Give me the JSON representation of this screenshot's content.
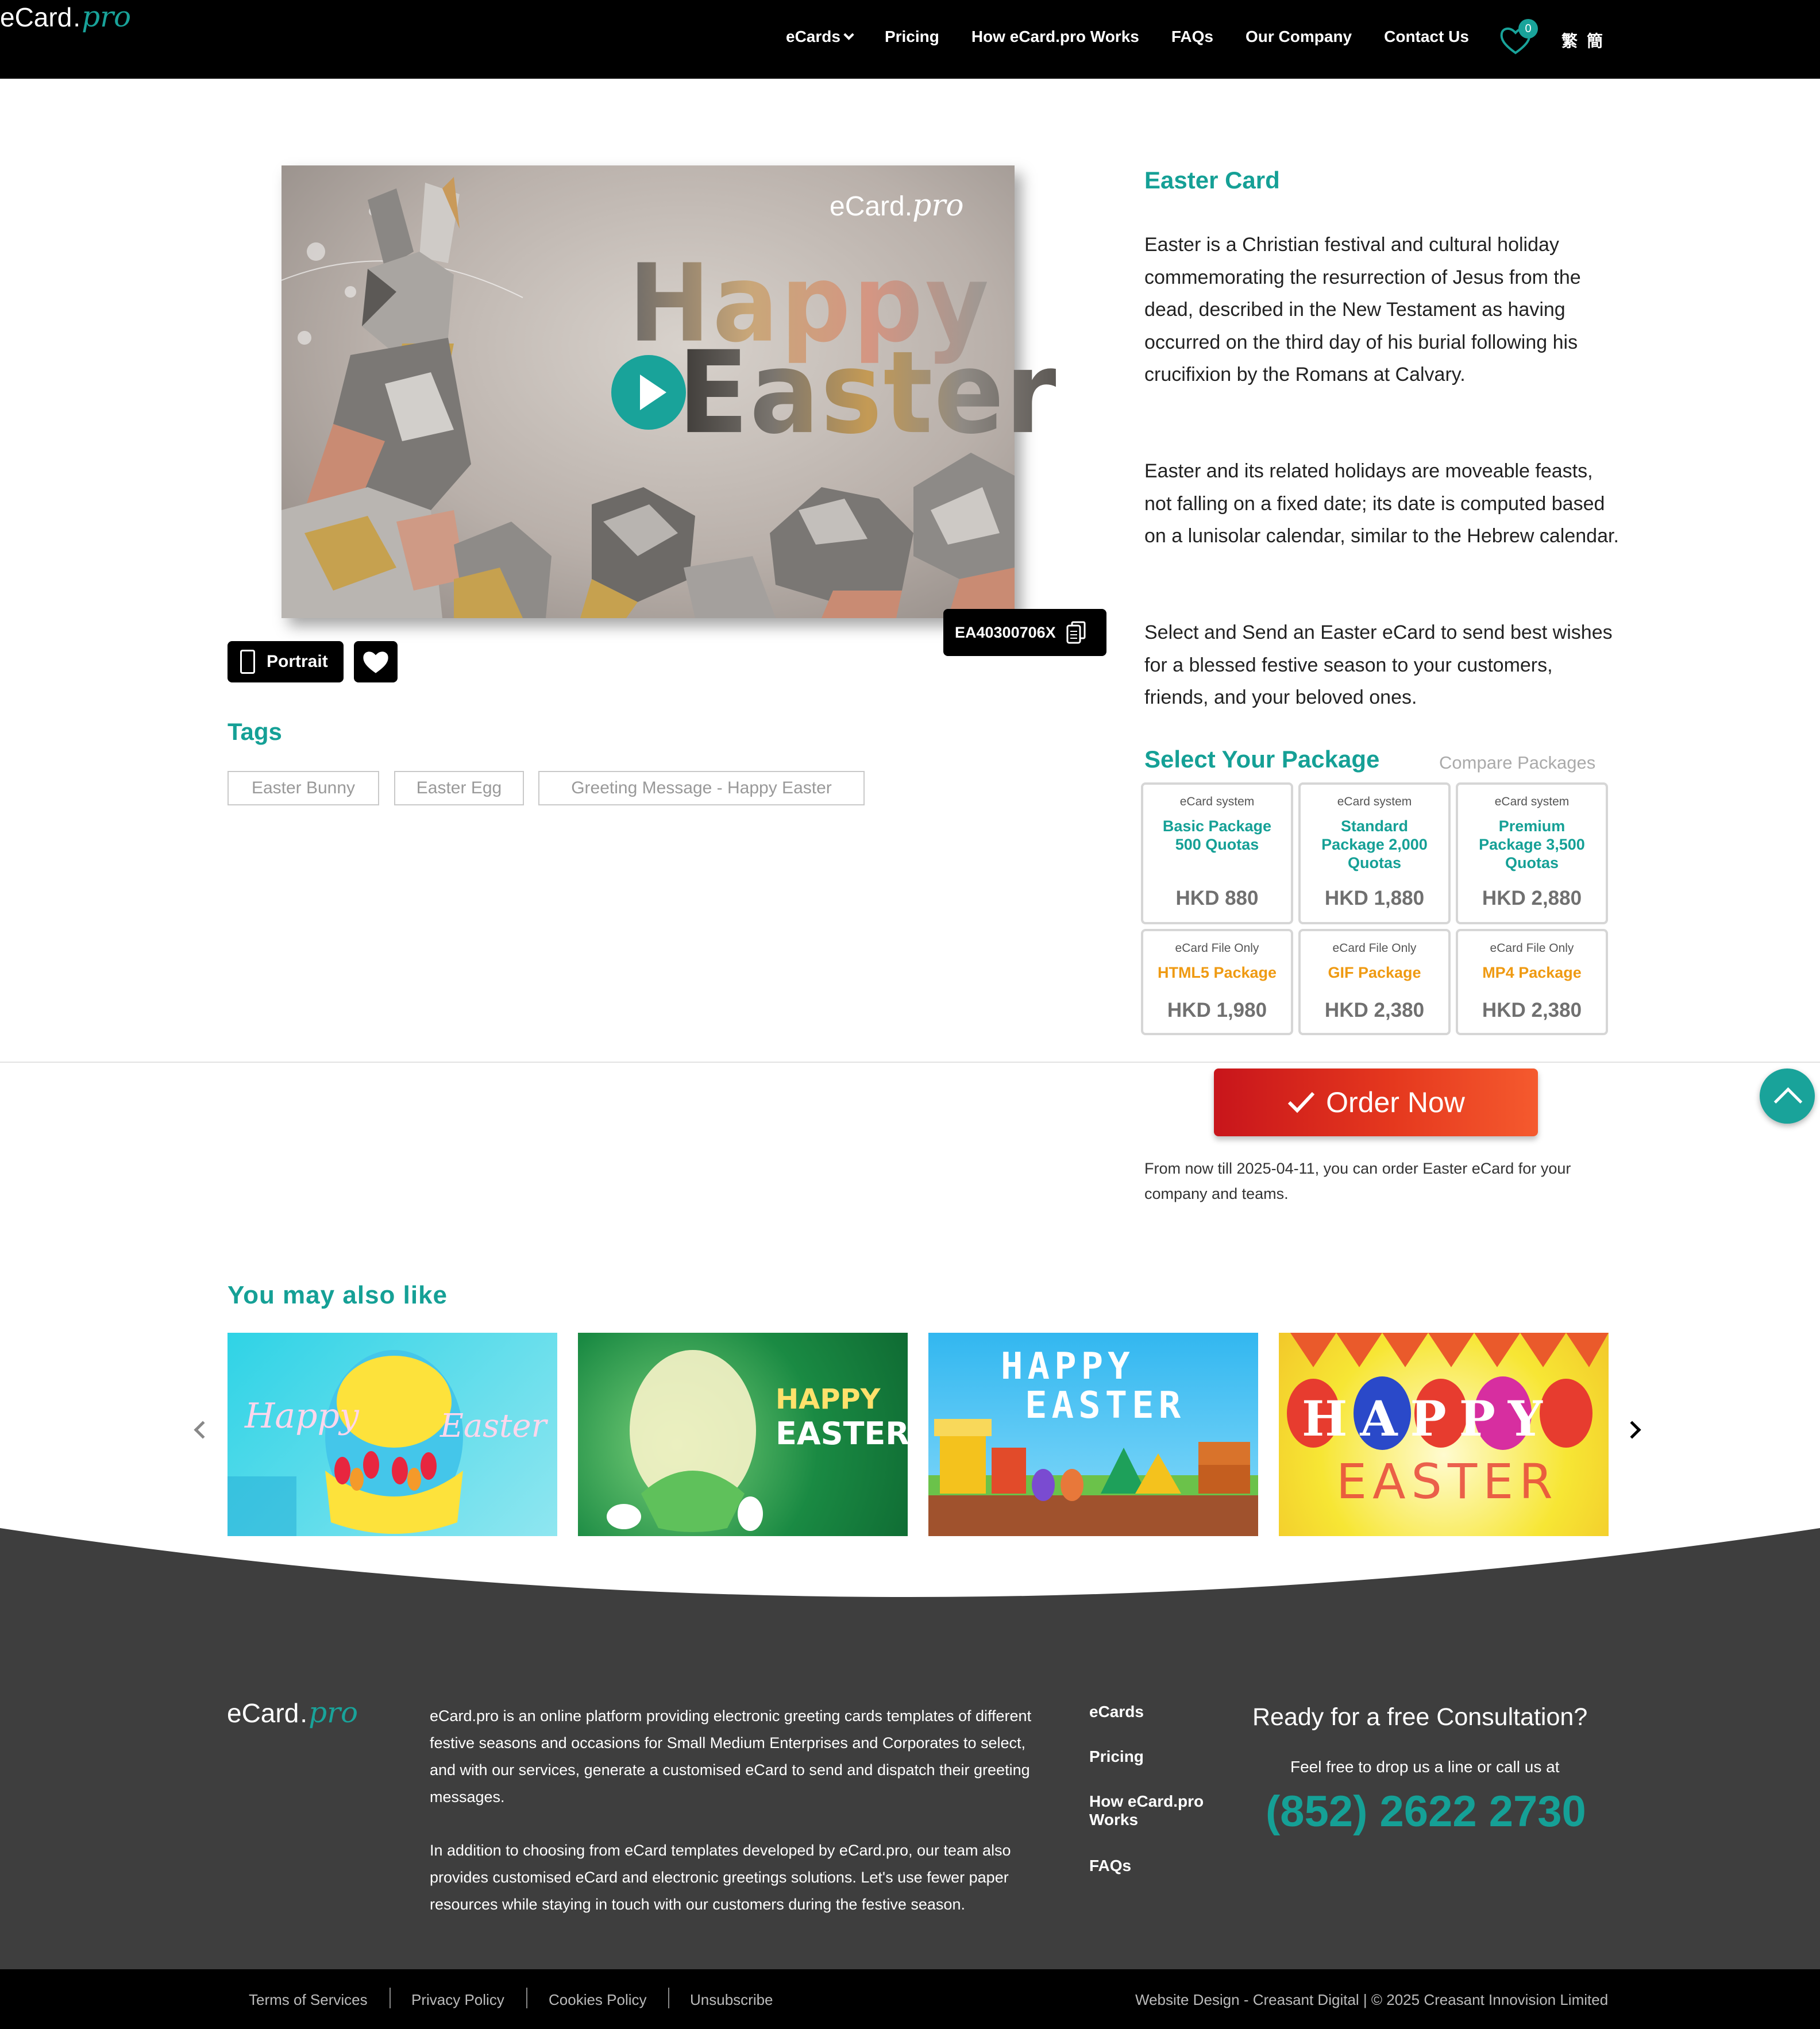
{
  "header": {
    "logo": {
      "main": "eCard",
      "dot": ".",
      "pro": "pro"
    },
    "nav": [
      "eCards",
      "Pricing",
      "How eCard.pro Works",
      "FAQs",
      "Our Company",
      "Contact Us"
    ],
    "favorites_count": "0",
    "lang_traditional": "繁",
    "lang_simplified": "簡"
  },
  "preview": {
    "watermark": {
      "main": "eCard",
      "dot": ".",
      "pro": "pro"
    },
    "headline_1": "Happy",
    "headline_2": "Easter",
    "code": "EA40300706X",
    "portrait_label": "Portrait"
  },
  "tags": {
    "title": "Tags",
    "items": [
      "Easter Bunny",
      "Easter Egg",
      "Greeting Message - Happy Easter"
    ]
  },
  "card": {
    "title": "Easter Card",
    "paragraphs": [
      "Easter is a Christian festival and cultural holiday commemorating the resurrection of Jesus from the dead, described in the New Testament as having occurred on the third day of his burial following his crucifixion by the Romans at Calvary.",
      "Easter and its related holidays are moveable feasts, not falling on a fixed date; its date is computed based on a lunisolar calendar, similar to the Hebrew calendar.",
      "Select and Send an Easter eCard to send best wishes for a blessed festive season to your customers, friends, and your beloved ones."
    ]
  },
  "packages": {
    "title": "Select Your Package",
    "compare": "Compare Packages",
    "system": [
      {
        "type": "eCard system",
        "name": "Basic Package\n500 Quotas",
        "price": "HKD 880"
      },
      {
        "type": "eCard system",
        "name": "Standard Package\n2,000 Quotas",
        "price": "HKD 1,880"
      },
      {
        "type": "eCard system",
        "name": "Premium Package\n3,500 Quotas",
        "price": "HKD 2,880"
      }
    ],
    "file": [
      {
        "type": "eCard File Only",
        "name": "HTML5 Package",
        "price": "HKD 1,980"
      },
      {
        "type": "eCard File Only",
        "name": "GIF Package",
        "price": "HKD 2,380"
      },
      {
        "type": "eCard File Only",
        "name": "MP4 Package",
        "price": "HKD 2,380"
      }
    ],
    "system_color": "#15a096",
    "file_color": "#ef9a12"
  },
  "order": {
    "label": "Order Now",
    "note": "From now till 2025-04-11, you can order Easter eCard for your company and teams."
  },
  "related": {
    "title": "You may also like",
    "thumbs": [
      {
        "text_1": "Happy",
        "text_2": "Easter"
      },
      {
        "text_1": "HAPPY",
        "text_2": "EASTER"
      },
      {
        "text_1": "HAPPY",
        "text_2": "EASTER"
      },
      {
        "text_1": "HAPPY",
        "text_2": "EASTER"
      }
    ]
  },
  "footer": {
    "logo": {
      "main": "eCard",
      "dot": ".",
      "pro": "pro"
    },
    "about_1": "eCard.pro is an online platform providing electronic greeting cards templates of different festive seasons and occasions for Small Medium Enterprises and Corporates to select, and with our services, generate a customised eCard to send and dispatch their greeting messages.",
    "about_2": "In addition to choosing from eCard templates developed by eCard.pro, our team also provides customised eCard and electronic greetings solutions. Let's use fewer paper resources while staying in touch with our customers during the festive season.",
    "links": [
      "eCards",
      "Pricing",
      "How eCard.pro Works",
      "FAQs"
    ],
    "ready": "Ready for a free Consultation?",
    "drop": "Feel free to drop us a line or call us at",
    "phone": "(852) 2622 2730",
    "bottom_links": [
      "Terms of Services",
      "Privacy Policy",
      "Cookies Policy",
      "Unsubscribe"
    ],
    "credit": "Website Design - Creasant Digital | © 2025 Creasant Innovision Limited"
  },
  "colors": {
    "accent": "#15a096",
    "order": "#e5381e",
    "footer": "#3e3e3e"
  }
}
